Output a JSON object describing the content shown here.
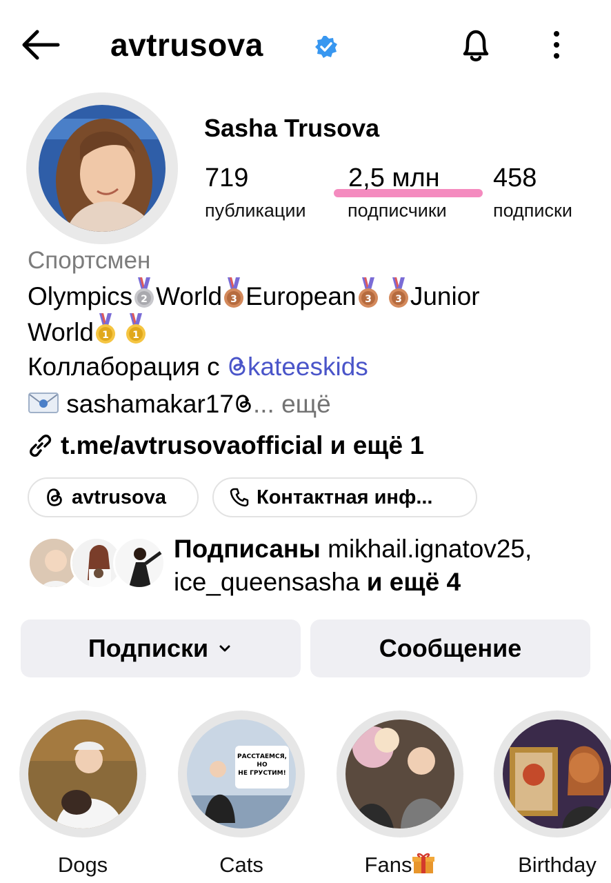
{
  "header": {
    "username": "avtrusova",
    "verified_color": "#3897f0"
  },
  "profile": {
    "full_name": "Sasha Trusova",
    "stats": [
      {
        "value": "719",
        "label": "публикации"
      },
      {
        "value": "2,5 млн",
        "label": "подписчики"
      },
      {
        "value": "458",
        "label": "подписки"
      }
    ],
    "highlight_color": "#f48bbf",
    "category": "Спортсмен",
    "bio_line1": {
      "a": "Olympics",
      "b": "World",
      "c": "European",
      "d": "Junior"
    },
    "bio_line2": {
      "a": "World"
    },
    "collab_prefix": "Коллаборация с",
    "collab_handle": "kateeskids",
    "email_text": "sashamakar17",
    "more_text": "... ещё",
    "link": "t.me/avtrusovaofficial и ещё 1",
    "mention_color": "#4a55c9"
  },
  "chips": {
    "threads": "avtrusova",
    "contact": "Контактная инф..."
  },
  "mutual": {
    "prefix": "Подписаны",
    "names": "mikhail.ignatov25,",
    "name2": "ice_queensasha",
    "suffix": "и ещё 4"
  },
  "buttons": {
    "following": "Подписки",
    "message": "Сообщение"
  },
  "highlights": [
    {
      "label": "Dogs"
    },
    {
      "label": "Cats"
    },
    {
      "label": "Fans"
    },
    {
      "label": "Birthday"
    }
  ],
  "story_sign": {
    "line1": "РАССТАЕМСЯ,",
    "line2": "НО",
    "line3": "НЕ ГРУСТИМ!"
  }
}
